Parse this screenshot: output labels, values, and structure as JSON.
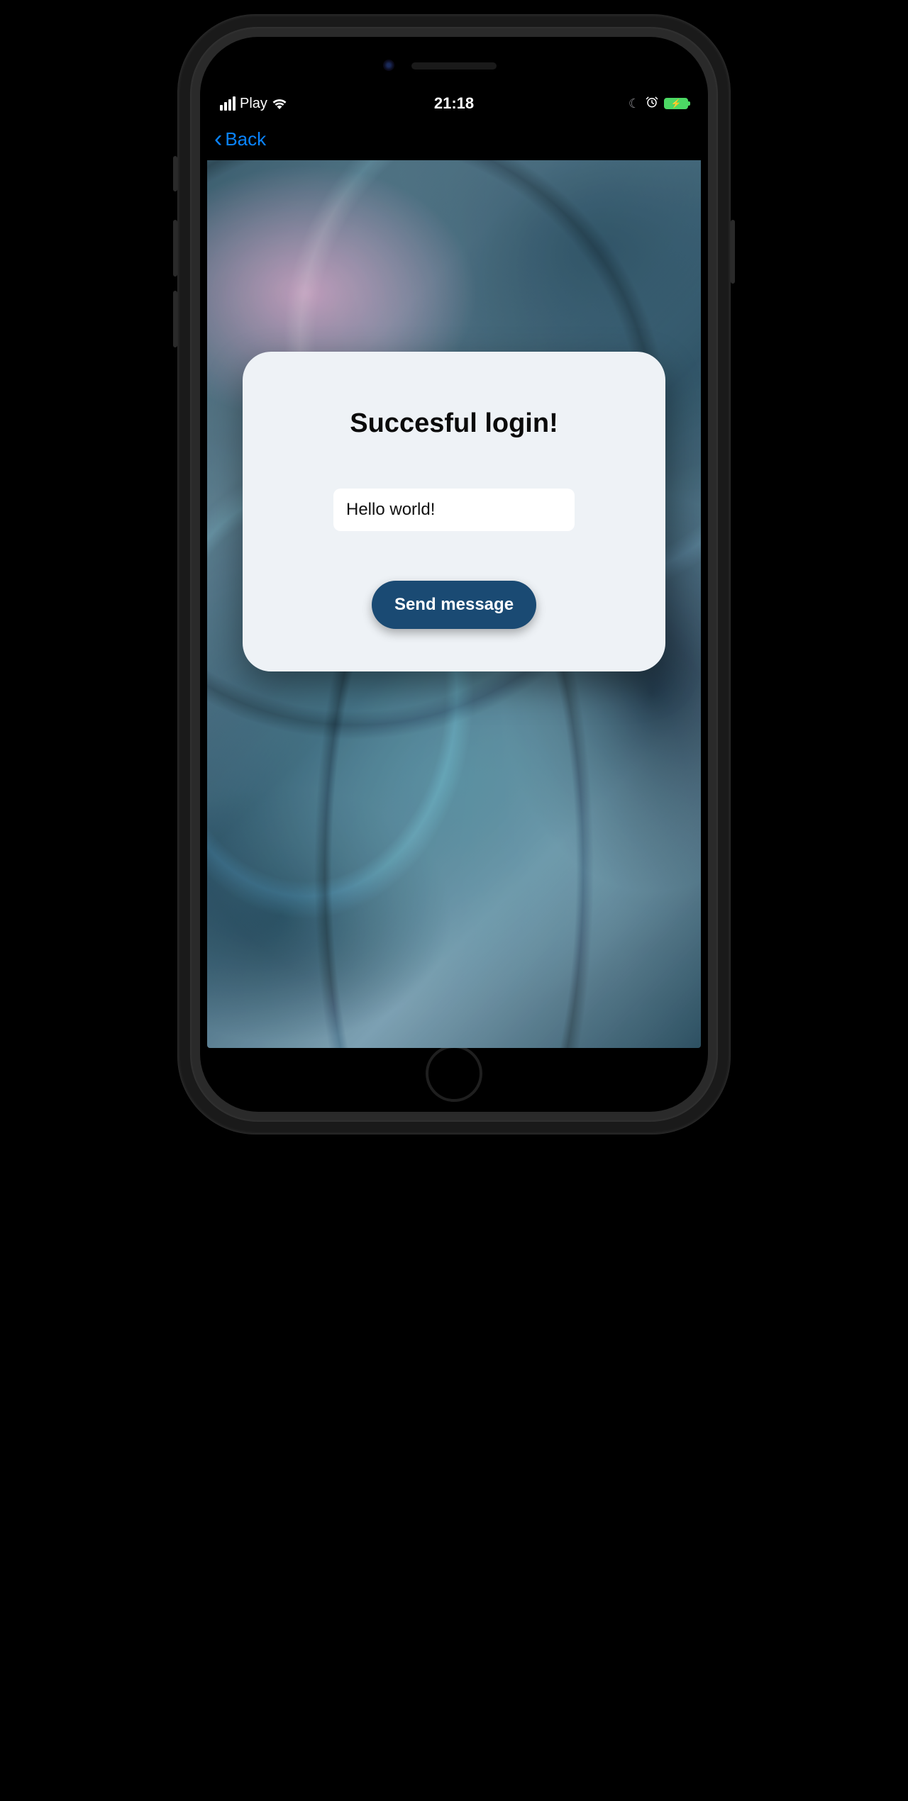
{
  "status_bar": {
    "carrier": "Play",
    "time": "21:18"
  },
  "nav": {
    "back_label": "Back"
  },
  "card": {
    "title": "Succesful login!",
    "input_value": "Hello world!",
    "button_label": "Send message"
  },
  "colors": {
    "ios_blue": "#0a84ff",
    "button_bg": "#1a4a73",
    "battery_green": "#4cd964"
  }
}
